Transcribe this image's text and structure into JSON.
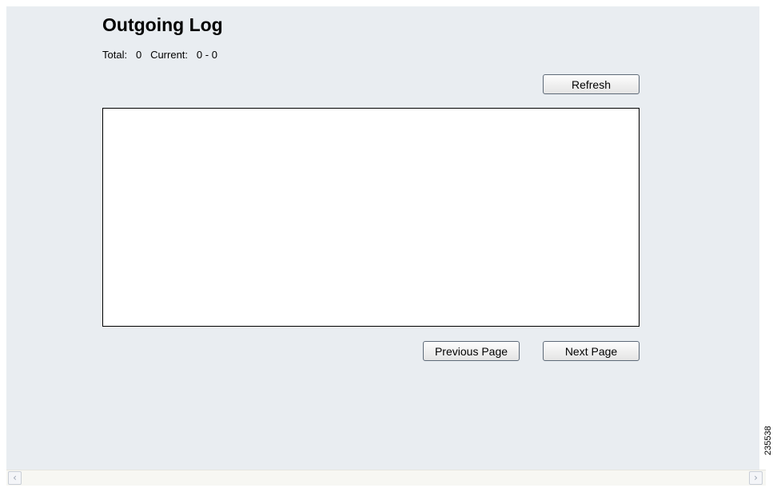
{
  "page": {
    "title": "Outgoing Log"
  },
  "counter": {
    "total_label": "Total:",
    "total_value": "0",
    "current_label": "Current:",
    "current_range": "0 - 0"
  },
  "toolbar": {
    "refresh_label": "Refresh"
  },
  "log": {
    "entries": []
  },
  "pagination": {
    "previous_label": "Previous Page",
    "next_label": "Next Page"
  },
  "scrollbar": {
    "left_icon": "chevron-left-icon",
    "right_icon": "chevron-right-icon"
  },
  "figure_id": "235538",
  "colors": {
    "panel_background": "#e9edf1",
    "log_background": "#ffffff",
    "button_border": "#5e6a78"
  }
}
